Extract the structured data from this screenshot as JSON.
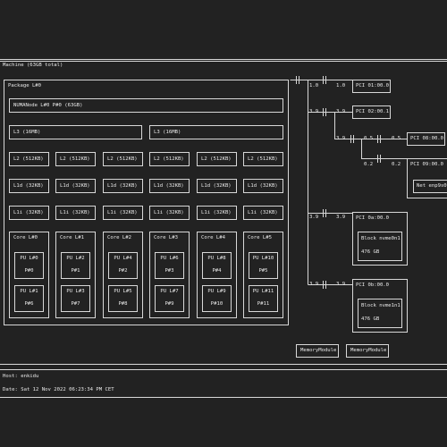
{
  "machine": {
    "label": "Machine (63GB total)",
    "package": {
      "label": "Package L#0",
      "numa": "NUMANode L#0 P#0 (63GB)",
      "l3": [
        "L3 (16MB)",
        "L3 (16MB)"
      ],
      "l2": [
        "L2 (512KB)",
        "L2 (512KB)",
        "L2 (512KB)",
        "L2 (512KB)",
        "L2 (512KB)",
        "L2 (512KB)"
      ],
      "l1d": [
        "L1d (32KB)",
        "L1d (32KB)",
        "L1d (32KB)",
        "L1d (32KB)",
        "L1d (32KB)",
        "L1d (32KB)"
      ],
      "l1i": [
        "L1i (32KB)",
        "L1i (32KB)",
        "L1i (32KB)",
        "L1i (32KB)",
        "L1i (32KB)",
        "L1i (32KB)"
      ],
      "cores": [
        {
          "label": "Core L#0",
          "pus": [
            {
              "l": "PU L#0",
              "p": "P#0"
            },
            {
              "l": "PU L#1",
              "p": "P#6"
            }
          ]
        },
        {
          "label": "Core L#1",
          "pus": [
            {
              "l": "PU L#2",
              "p": "P#1"
            },
            {
              "l": "PU L#3",
              "p": "P#7"
            }
          ]
        },
        {
          "label": "Core L#2",
          "pus": [
            {
              "l": "PU L#4",
              "p": "P#2"
            },
            {
              "l": "PU L#5",
              "p": "P#8"
            }
          ]
        },
        {
          "label": "Core L#3",
          "pus": [
            {
              "l": "PU L#6",
              "p": "P#3"
            },
            {
              "l": "PU L#7",
              "p": "P#9"
            }
          ]
        },
        {
          "label": "Core L#4",
          "pus": [
            {
              "l": "PU L#8",
              "p": "P#4"
            },
            {
              "l": "PU L#9",
              "p": "P#10"
            }
          ]
        },
        {
          "label": "Core L#5",
          "pus": [
            {
              "l": "PU L#10",
              "p": "P#5"
            },
            {
              "l": "PU L#11",
              "p": "P#11"
            }
          ]
        }
      ]
    },
    "pci": {
      "p1": {
        "label": "PCI 01:00.0",
        "speed_a": "1.0",
        "speed_b": "1.0"
      },
      "p2": {
        "label": "PCI 02:00.1",
        "speed_a": "3.9",
        "speed_b": "3.9"
      },
      "p3": {
        "label": "PCI 08:00.0",
        "speed_a": "3.9",
        "speed_b": "0.5",
        "speed_c": "0.5"
      },
      "p4": {
        "label": "PCI 09:00.0",
        "speed_a": "0.2",
        "speed_b": "0.2",
        "dev": "Net enp9s0"
      },
      "p5": {
        "label": "PCI 0a:00.0",
        "speed_a": "3.9",
        "speed_b": "3.9",
        "dev": "Block nvme0n1",
        "size": "476 GB"
      },
      "p6": {
        "label": "PCI 0b:00.0",
        "speed_a": "3.9",
        "speed_b": "3.9",
        "dev": "Block nvme1n1",
        "size": "476 GB"
      }
    },
    "memory_modules": [
      "MemoryModule",
      "MemoryModule"
    ]
  },
  "footer": {
    "host": "Host: enkidu",
    "date": "Date: Sat 12 Nov 2022 06:23:34 PM CET"
  },
  "colors": {
    "background": "#222222",
    "line": "#d8d8d8",
    "text": "#e8e8e8"
  }
}
